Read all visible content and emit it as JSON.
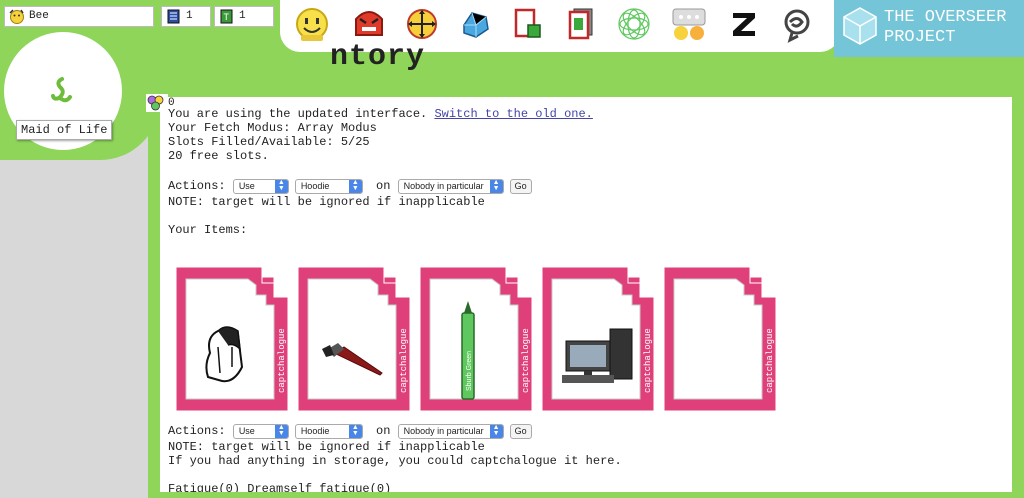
{
  "status": {
    "username": "Bee",
    "count_a": "1",
    "count_b": "1"
  },
  "toolbar": {
    "icons": [
      "smiley-icon",
      "angry-face-icon",
      "crosshair-icon",
      "crystal-icon",
      "card-icon",
      "stack-icon",
      "spirograph-icon",
      "chat-icon",
      "z-icon",
      "swirl-icon"
    ]
  },
  "banner": {
    "line1": "THE OVERSEER",
    "line2": "PROJECT"
  },
  "page_title": "ntory",
  "character": {
    "class_label": "Maid of Life"
  },
  "boondollars": "0",
  "content": {
    "interface_text": "You are using the updated interface. ",
    "switch_link": "Switch to the old one.",
    "fetch_modus": "Your Fetch Modus: Array Modus",
    "slots": "Slots Filled/Available: 5/25",
    "free": "20 free slots.",
    "actions_label": "Actions: ",
    "on_label": " on ",
    "action_value": "Use",
    "item_value": "Hoodie",
    "target_value": "Nobody in particular",
    "go_label": "Go",
    "note": "NOTE: target will be ignored if inapplicable",
    "your_items": "Your Items:",
    "storage_note": "If you had anything in storage, you could captchalogue it here.",
    "fatigue": "Fatigue(0) Dreamself fatigue(0)"
  },
  "cards": [
    {
      "item": "hoodie",
      "captcha": "captchalogue"
    },
    {
      "item": "paintbrush",
      "captcha": "captchalogue"
    },
    {
      "item": "marker",
      "captcha": "captchalogue"
    },
    {
      "item": "computer",
      "captcha": "captchalogue"
    },
    {
      "item": "empty",
      "captcha": "captchalogue"
    }
  ],
  "colors": {
    "green": "#8ed55a",
    "card_pink": "#e0407a",
    "banner_blue": "#74c5d8",
    "link": "#4444aa"
  }
}
